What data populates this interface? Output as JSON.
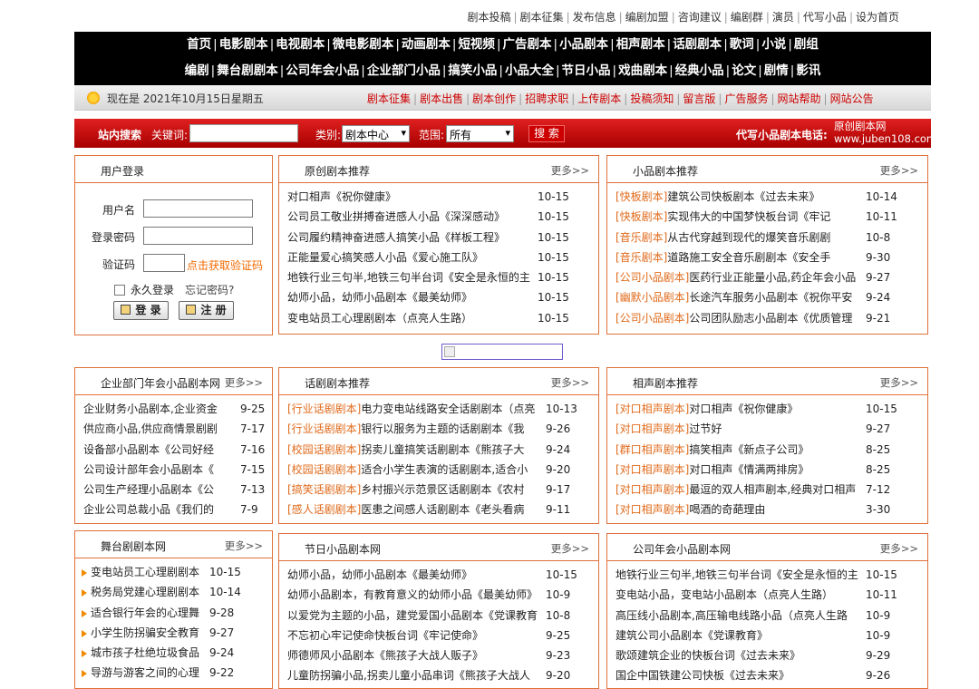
{
  "top_links": [
    "剧本投稿",
    "剧本征集",
    "发布信息",
    "编剧加盟",
    "咨询建议",
    "编剧群",
    "演员",
    "代写小品",
    "设为首页"
  ],
  "nav_row1": [
    "首页",
    "电影剧本",
    "电视剧本",
    "微电影剧本",
    "动画剧本",
    "短视频",
    "广告剧本",
    "小品剧本",
    "相声剧本",
    "话剧剧本",
    "歌词",
    "小说",
    "剧组"
  ],
  "nav_row2": [
    "编剧",
    "舞台剧剧本",
    "公司年会小品",
    "企业部门小品",
    "搞笑小品",
    "小品大全",
    "节日小品",
    "戏曲剧本",
    "经典小品",
    "论文",
    "剧情",
    "影讯"
  ],
  "info": {
    "date": "现在是 2021年10月15日星期五",
    "links": [
      "剧本征集",
      "剧本出售",
      "剧本创作",
      "招聘求职",
      "上传剧本",
      "投稿须知",
      "留言版",
      "广告服务",
      "网站帮助",
      "网站公告"
    ]
  },
  "search": {
    "site_search": "站内搜索",
    "keyword_label": "关键词:",
    "category_label": "类别:",
    "category_value": "剧本中心",
    "scope_label": "范围:",
    "scope_value": "所有",
    "button": "搜 索",
    "phone_label": "代写小品剧本电话:",
    "brand_line1": "原创剧本网",
    "brand_line2": "www.juben108.com"
  },
  "login": {
    "title": "用户登录",
    "username_label": "用户名",
    "password_label": "登录密码",
    "captcha_label": "验证码",
    "get_code": "点击获取验证码",
    "remember": "永久登录",
    "forgot": "忘记密码?",
    "login_btn": "登 录",
    "register_btn": "注 册"
  },
  "more_label": "更多>>",
  "boxes": {
    "original": {
      "title": "原创剧本推荐",
      "items": [
        {
          "tag": "",
          "text": "对口相声《祝你健康》",
          "date": "10-15"
        },
        {
          "tag": "",
          "text": "公司员工敬业拼搏奋进感人小品《深深感动》",
          "date": "10-15"
        },
        {
          "tag": "",
          "text": "公司履约精神奋进感人搞笑小品《样板工程》",
          "date": "10-15"
        },
        {
          "tag": "",
          "text": "正能量爱心搞笑感人小品《爱心施工队》",
          "date": "10-15"
        },
        {
          "tag": "",
          "text": "地铁行业三句半,地铁三句半台词《安全是永恒的主",
          "date": "10-15"
        },
        {
          "tag": "",
          "text": "幼师小品，幼师小品剧本《最美幼师》",
          "date": "10-15"
        },
        {
          "tag": "",
          "text": "变电站员工心理剧剧本（点亮人生路）",
          "date": "10-15"
        }
      ]
    },
    "xiaopin": {
      "title": "小品剧本推荐",
      "items": [
        {
          "tag": "[快板剧本]",
          "text": "建筑公司快板剧本《过去未来》",
          "date": "10-14"
        },
        {
          "tag": "[快板剧本]",
          "text": "实现伟大的中国梦快板台词《牢记",
          "date": "10-11"
        },
        {
          "tag": "[音乐剧本]",
          "text": "从古代穿越到现代的爆笑音乐剧剧",
          "date": "10-8"
        },
        {
          "tag": "[音乐剧本]",
          "text": "道路施工安全音乐剧剧本《安全手",
          "date": "9-30"
        },
        {
          "tag": "[公司小品剧本]",
          "text": "医药行业正能量小品,药企年会小品",
          "date": "9-27"
        },
        {
          "tag": "[幽默小品剧本]",
          "text": "长途汽车服务小品剧本《祝你平安",
          "date": "9-24"
        },
        {
          "tag": "[公司小品剧本]",
          "text": "公司团队励志小品剧本《优质管理",
          "date": "9-21"
        }
      ]
    },
    "enterprise": {
      "title": "企业部门年会小品剧本网",
      "items": [
        {
          "tag": "",
          "text": "企业财务小品剧本,企业资金",
          "date": "9-25"
        },
        {
          "tag": "",
          "text": "供应商小品,供应商情景剧剧",
          "date": "7-17"
        },
        {
          "tag": "",
          "text": "设备部小品剧本《公司好经",
          "date": "7-16"
        },
        {
          "tag": "",
          "text": "公司设计部年会小品剧本《",
          "date": "7-15"
        },
        {
          "tag": "",
          "text": "公司生产经理小品剧本《公",
          "date": "7-13"
        },
        {
          "tag": "",
          "text": "企业公司总裁小品《我们的",
          "date": "7-9"
        }
      ]
    },
    "drama": {
      "title": "话剧剧本推荐",
      "items": [
        {
          "tag": "[行业话剧剧本]",
          "text": "电力变电站线路安全话剧剧本（点亮",
          "date": "10-13"
        },
        {
          "tag": "[行业话剧剧本]",
          "text": "银行以服务为主题的话剧剧本《我",
          "date": "9-26"
        },
        {
          "tag": "[校园话剧剧本]",
          "text": "拐卖儿童搞笑话剧剧本《熊孩子大",
          "date": "9-24"
        },
        {
          "tag": "[校园话剧剧本]",
          "text": "适合小学生表演的话剧剧本,适合小",
          "date": "9-20"
        },
        {
          "tag": "[搞笑话剧剧本]",
          "text": "乡村振兴示范景区话剧剧本《农村",
          "date": "9-17"
        },
        {
          "tag": "[感人话剧剧本]",
          "text": "医患之间感人话剧剧本《老头看病",
          "date": "9-11"
        }
      ]
    },
    "crosstalk": {
      "title": "相声剧本推荐",
      "items": [
        {
          "tag": "[对口相声剧本]",
          "text": "对口相声《祝你健康》",
          "date": "10-15"
        },
        {
          "tag": "[对口相声剧本]",
          "text": "过节好",
          "date": "9-27"
        },
        {
          "tag": "[群口相声剧本]",
          "text": "搞笑相声《新点子公司》",
          "date": "8-25"
        },
        {
          "tag": "[对口相声剧本]",
          "text": "对口相声《情满两排房》",
          "date": "8-25"
        },
        {
          "tag": "[对口相声剧本]",
          "text": "最逗的双人相声剧本,经典对口相声",
          "date": "7-12"
        },
        {
          "tag": "[对口相声剧本]",
          "text": "喝酒的奇葩理由",
          "date": "3-30"
        }
      ]
    },
    "stage": {
      "title": "舞台剧剧本网",
      "items": [
        {
          "tag": "",
          "text": "变电站员工心理剧剧本",
          "date": "10-15"
        },
        {
          "tag": "",
          "text": "税务局党建心理剧剧本",
          "date": "10-14"
        },
        {
          "tag": "",
          "text": "适合银行年会的心理舞",
          "date": "9-28"
        },
        {
          "tag": "",
          "text": "小学生防拐骗安全教育",
          "date": "9-27"
        },
        {
          "tag": "",
          "text": "城市孩子杜绝垃圾食品",
          "date": "9-24"
        },
        {
          "tag": "",
          "text": "导游与游客之间的心理",
          "date": "9-22"
        }
      ]
    },
    "festival": {
      "title": "节日小品剧本网",
      "items": [
        {
          "tag": "",
          "text": "幼师小品，幼师小品剧本《最美幼师》",
          "date": "10-15"
        },
        {
          "tag": "",
          "text": "幼师小品剧本，有教育意义的幼师小品《最美幼师》",
          "date": "10-9"
        },
        {
          "tag": "",
          "text": "以爱党为主题的小品，建党爱国小品剧本《党课教育",
          "date": "10-8"
        },
        {
          "tag": "",
          "text": "不忘初心牢记使命快板台词《牢记使命》",
          "date": "9-25"
        },
        {
          "tag": "",
          "text": "师德师风小品剧本《熊孩子大战人贩子》",
          "date": "9-23"
        },
        {
          "tag": "",
          "text": "儿童防拐骗小品,拐卖儿童小品串词《熊孩子大战人",
          "date": "9-20"
        }
      ]
    },
    "annual": {
      "title": "公司年会小品剧本网",
      "items": [
        {
          "tag": "",
          "text": "地铁行业三句半,地铁三句半台词《安全是永恒的主",
          "date": "10-15"
        },
        {
          "tag": "",
          "text": "变电站小品，变电站小品剧本（点亮人生路）",
          "date": "10-11"
        },
        {
          "tag": "",
          "text": "高压线小品剧本,高压输电线路小品（点亮人生路",
          "date": "10-9"
        },
        {
          "tag": "",
          "text": "建筑公司小品剧本《党课教育》",
          "date": "10-9"
        },
        {
          "tag": "",
          "text": "歌颂建筑企业的快板台词《过去未来》",
          "date": "9-29"
        },
        {
          "tag": "",
          "text": "国企中国铁建公司快板《过去未来》",
          "date": "9-26"
        }
      ]
    }
  }
}
